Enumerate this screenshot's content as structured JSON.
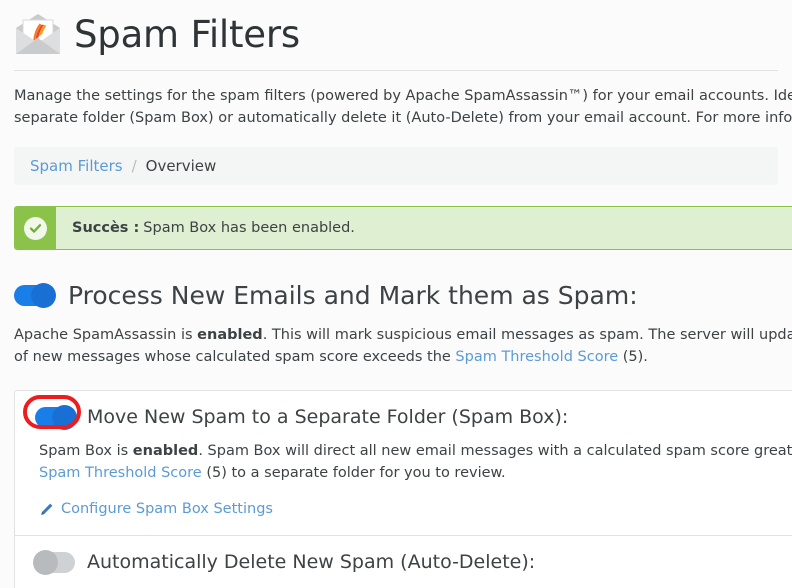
{
  "header": {
    "title": "Spam Filters",
    "icon": "spam-envelope-apache-feather-icon"
  },
  "description": {
    "line1": "Manage the settings for the spam filters (powered by Apache SpamAssassin™) for your email accounts. Identify unsolicit",
    "line2": "separate folder (Spam Box) or automatically delete it (Auto-Delete) from your email account. For more information, read"
  },
  "breadcrumb": {
    "root": "Spam Filters",
    "separator": "/",
    "current": "Overview"
  },
  "alert": {
    "icon": "check-circle-icon",
    "label": "Succès :",
    "message": "Spam Box has been enabled.",
    "bg_color": "#dff0d2",
    "accent_color": "#8bc34a"
  },
  "process_section": {
    "toggle": {
      "name": "process-new-emails-toggle",
      "state": "on",
      "color": "#1a7ee8"
    },
    "heading": "Process New Emails and Mark them as Spam:",
    "text": {
      "l1_a": "Apache SpamAssassin is ",
      "l1_b": "enabled",
      "l1_c": ". This will mark suspicious email messages as spam. The server will update the header",
      "l2_a": "of new messages whose calculated spam score exceeds the ",
      "l2_link": "Spam Threshold Score",
      "l2_b": " (5)."
    }
  },
  "spam_box_section": {
    "toggle": {
      "name": "spam-box-toggle",
      "state": "on",
      "color": "#1a7ee8",
      "highlight_color": "#ee1c1c"
    },
    "heading": "Move New Spam to a Separate Folder (Spam Box):",
    "text": {
      "l1_a": "Spam Box is ",
      "l1_b": "enabled",
      "l1_c": ". Spam Box will direct all new email messages with a calculated spam score greater than the",
      "l2_link": "Spam Threshold Score",
      "l2_b": " (5) to a separate folder for you to review."
    },
    "configure_link": {
      "icon": "pencil-icon",
      "label": "Configure Spam Box Settings"
    }
  },
  "auto_delete_section": {
    "toggle": {
      "name": "auto-delete-toggle",
      "state": "off",
      "color": "#cfd2d4"
    },
    "heading": "Automatically Delete New Spam (Auto-Delete):"
  }
}
